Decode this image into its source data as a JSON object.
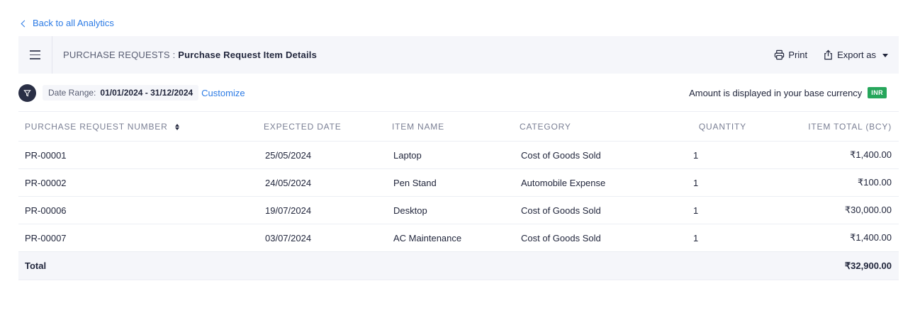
{
  "nav": {
    "back_label": "Back to all Analytics"
  },
  "header": {
    "report_type": "PURCHASE REQUESTS :",
    "report_name": "Purchase Request Item Details",
    "print_label": "Print",
    "export_label": "Export as"
  },
  "filters": {
    "date_range_label": "Date Range:",
    "date_range_value": "01/01/2024 - 31/12/2024",
    "customize_label": "Customize",
    "currency_note": "Amount is displayed in your base currency",
    "currency_badge": "INR"
  },
  "table": {
    "columns": [
      "PURCHASE REQUEST NUMBER",
      "EXPECTED DATE",
      "ITEM NAME",
      "CATEGORY",
      "QUANTITY",
      "ITEM TOTAL (BCY)"
    ],
    "rows": [
      {
        "number": "PR-00001",
        "date": "25/05/2024",
        "item": "Laptop",
        "category": "Cost of Goods Sold",
        "quantity": "1",
        "total": "₹1,400.00"
      },
      {
        "number": "PR-00002",
        "date": "24/05/2024",
        "item": "Pen Stand",
        "category": "Automobile Expense",
        "quantity": "1",
        "total": "₹100.00"
      },
      {
        "number": "PR-00006",
        "date": "19/07/2024",
        "item": "Desktop",
        "category": "Cost of Goods Sold",
        "quantity": "1",
        "total": "₹30,000.00"
      },
      {
        "number": "PR-00007",
        "date": "03/07/2024",
        "item": "AC Maintenance",
        "category": "Cost of Goods Sold",
        "quantity": "1",
        "total": "₹1,400.00"
      }
    ],
    "total_label": "Total",
    "total_value": "₹32,900.00"
  },
  "colors": {
    "accent": "#2c7be5",
    "badge": "#26a65b",
    "header_bg": "#f5f6fa"
  }
}
